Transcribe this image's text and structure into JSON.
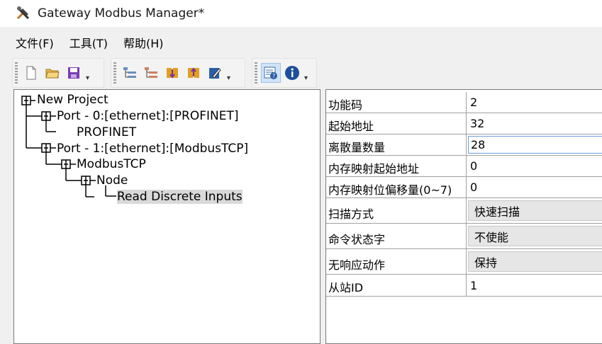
{
  "window": {
    "title": "Gateway Modbus Manager*"
  },
  "menu": [
    "文件(F)",
    "工具(T)",
    "帮助(H)"
  ],
  "toolbar": {
    "group1": [
      "new-file-icon",
      "open-folder-icon",
      "save-icon"
    ],
    "group2": [
      "add-port-icon",
      "remove-port-icon",
      "move-down-icon",
      "move-up-icon",
      "edit-icon"
    ],
    "group3": [
      "properties-help-icon",
      "info-icon"
    ]
  },
  "tree": {
    "root": "New Project",
    "port0": "Port - 0:[ethernet]:[PROFINET]",
    "port0_child": "PROFINET",
    "port1": "Port - 1:[ethernet]:[ModbusTCP]",
    "port1_child": "ModbusTCP",
    "node": "Node",
    "command": "Read Discrete Inputs"
  },
  "properties": [
    {
      "name": "功能码",
      "value": "2"
    },
    {
      "name": "起始地址",
      "value": "32"
    },
    {
      "name": "离散量数量",
      "value": "28"
    },
    {
      "name": "内存映射起始地址",
      "value": "0"
    },
    {
      "name": "内存映射位偏移量(0~7)",
      "value": "0"
    },
    {
      "name": "扫描方式",
      "value": "快速扫描"
    },
    {
      "name": "命令状态字",
      "value": "不使能"
    },
    {
      "name": "无响应动作",
      "value": "保持"
    },
    {
      "name": "从站ID",
      "value": "1"
    }
  ],
  "colors": {
    "selection": "#d9d9d9",
    "focus_border": "#6aa0d8"
  }
}
